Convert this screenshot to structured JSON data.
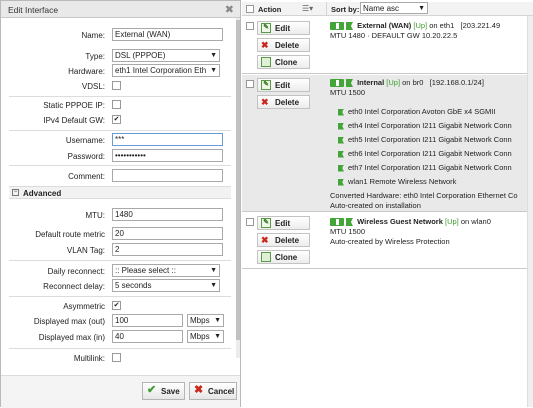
{
  "dialog": {
    "title": "Edit Interface",
    "close_glyph": "✖",
    "name_label": "Name:",
    "name_value": "External (WAN)",
    "type_label": "Type:",
    "type_value": "DSL (PPPOE)",
    "hardware_label": "Hardware:",
    "hardware_value": "eth1 Intel Corporation Eth",
    "vdsl_label": "VDSL:",
    "static_ip_label": "Static PPPOE IP:",
    "ipv4_gw_label": "IPv4 Default GW:",
    "username_label": "Username:",
    "username_value": "***",
    "password_label": "Password:",
    "password_value": "•••••••••••",
    "comment_label": "Comment:",
    "comment_value": "",
    "advanced_label": "Advanced",
    "mtu_label": "MTU:",
    "mtu_value": "1480",
    "route_metric_label": "Default route metric",
    "route_metric_value": "20",
    "vlan_label": "VLAN Tag:",
    "vlan_value": "2",
    "daily_reconnect_label": "Daily reconnect:",
    "daily_reconnect_value": ":: Please select ::",
    "reconnect_delay_label": "Reconnect delay:",
    "reconnect_delay_value": "5 seconds",
    "asymmetric_label": "Asymmetric",
    "max_out_label": "Displayed max (out)",
    "max_out_value": "100",
    "max_out_unit": "Mbps",
    "max_in_label": "Displayed max (in)",
    "max_in_value": "40",
    "max_in_unit": "Mbps",
    "multilink_label": "Multilink:",
    "save_label": "Save",
    "cancel_label": "Cancel"
  },
  "grid": {
    "header_action": "Action",
    "header_menu_glyph": "☰▾",
    "sort_label": "Sort by:",
    "sort_value": "Name asc",
    "records": [
      {
        "edit": "Edit",
        "delete": "Delete",
        "clone": "Clone",
        "name": "External (WAN)",
        "status": "[Up]",
        "device": "on eth1",
        "address": "[203.221.49",
        "line2": "MTU 1480 · DEFAULT GW 10.20.22.5"
      },
      {
        "edit": "Edit",
        "delete": "Delete",
        "name": "Internal",
        "status": "[Up]",
        "device": "on br0",
        "address": "[192.168.0.1/24]",
        "line2": "MTU 1500",
        "members": [
          "eth0 Intel Corporation Avoton GbE x4 SGMII",
          "eth4 Intel Corporation I211 Gigabit Network Conn",
          "eth5 Intel Corporation I211 Gigabit Network Conn",
          "eth6 Intel Corporation I211 Gigabit Network Conn",
          "eth7 Intel Corporation I211 Gigabit Network Conn",
          "wlan1 Remote Wireless Network"
        ],
        "converted": "Converted Hardware: eth0 Intel Corporation Ethernet Co",
        "auto": "Auto-created on installation"
      },
      {
        "edit": "Edit",
        "delete": "Delete",
        "clone": "Clone",
        "name": "Wireless Guest Network",
        "status": "[Up]",
        "device": "on wlan0",
        "line2": "MTU 1500",
        "auto": "Auto-created by Wireless Protection"
      }
    ]
  },
  "icons": {
    "check": "✔",
    "cross": "✖",
    "arrow": "▼",
    "minus": "−"
  }
}
